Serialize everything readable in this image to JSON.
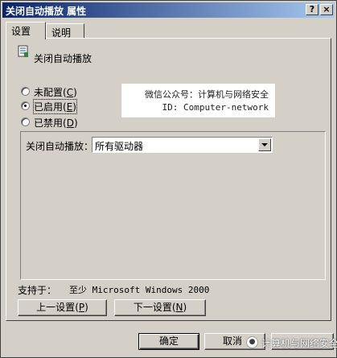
{
  "window": {
    "title": "关闭自动播放 属性",
    "help_glyph": "?",
    "close_glyph": "×"
  },
  "tabs": [
    {
      "label": "设置",
      "active": true
    },
    {
      "label": "说明",
      "active": false
    }
  ],
  "policy": {
    "name": "关闭自动播放",
    "icon": "policy-scroll-icon"
  },
  "radios": [
    {
      "label": "未配置",
      "key": "C",
      "selected": false
    },
    {
      "label": "已启用",
      "key": "E",
      "selected": true
    },
    {
      "label": "已禁用",
      "key": "D",
      "selected": false
    }
  ],
  "watermark": {
    "line1": "微信公众号：计算机与网络安全",
    "line2": "ID: Computer-network"
  },
  "options": {
    "label": "关闭自动播放：",
    "combo_value": "所有驱动器"
  },
  "supported": {
    "label": "支持于：",
    "value": "至少 Microsoft Windows 2000"
  },
  "nav": {
    "prev_label": "上一设置",
    "prev_key": "P",
    "next_label": "下一设置",
    "next_key": "N"
  },
  "footer": {
    "ok_label": "确定",
    "cancel_label": "取消"
  },
  "brand": {
    "text": "计算机与网络安全",
    "icon": "wechat-icon"
  },
  "colors": {
    "face": "#d4d0c8",
    "title_start": "#0a246a",
    "title_end": "#a6caf0"
  }
}
